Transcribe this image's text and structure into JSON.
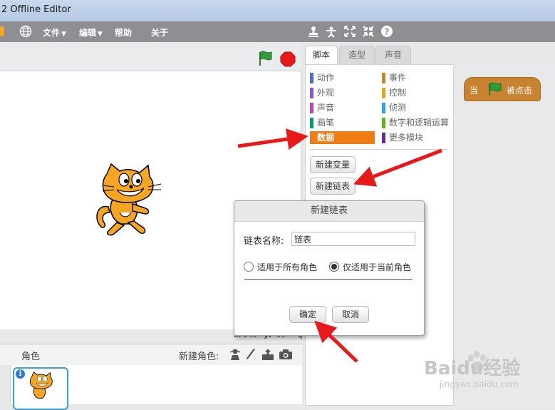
{
  "window": {
    "title": "2 Offline Editor"
  },
  "menu": {
    "file": "文件",
    "edit": "编辑",
    "help": "帮助",
    "about": "关于"
  },
  "toolbar_icons": [
    "stamp-icon",
    "cut-icon",
    "grow-icon",
    "shrink-icon",
    "help-icon"
  ],
  "stage": {
    "x_label": "x:",
    "x_value": "240",
    "y_label": "y:",
    "y_value": "-13"
  },
  "sprites": {
    "title": "角色",
    "new_sprite_label": "新建角色:"
  },
  "tabs": [
    {
      "label": "脚本",
      "active": true
    },
    {
      "label": "造型",
      "active": false
    },
    {
      "label": "声音",
      "active": false
    }
  ],
  "categories": {
    "left": [
      {
        "label": "动作",
        "color": "#4a6cd4"
      },
      {
        "label": "外观",
        "color": "#8a55d7"
      },
      {
        "label": "声音",
        "color": "#bb42c3"
      },
      {
        "label": "画笔",
        "color": "#0e9a6c"
      },
      {
        "label": "数据",
        "color": "#ee7d16",
        "selected": true
      }
    ],
    "right": [
      {
        "label": "事件",
        "color": "#c88330"
      },
      {
        "label": "控制",
        "color": "#e1a91a"
      },
      {
        "label": "侦测",
        "color": "#2ca5e2"
      },
      {
        "label": "数字和逻辑运算",
        "color": "#5cb712"
      },
      {
        "label": "更多模块",
        "color": "#632d99"
      }
    ]
  },
  "palette_buttons": {
    "new_variable": "新建变量",
    "new_list": "新建链表"
  },
  "script_block": {
    "prefix": "当",
    "suffix": "被点击"
  },
  "dialog": {
    "title": "新建链表",
    "name_label": "链表名称:",
    "name_value": "链表",
    "option_all": "适用于所有角色",
    "option_current": "仅适用于当前角色",
    "selected_option": "current",
    "ok": "确定",
    "cancel": "取消"
  },
  "watermark": {
    "brand": "Baidu经验",
    "url": "jingyan.baidu.com"
  },
  "colors": {
    "arrow": "#e8191b",
    "data_category": "#ee7d16",
    "events_block": "#c88330",
    "green_flag": "#2e9d3a",
    "stop": "#e8191b"
  }
}
